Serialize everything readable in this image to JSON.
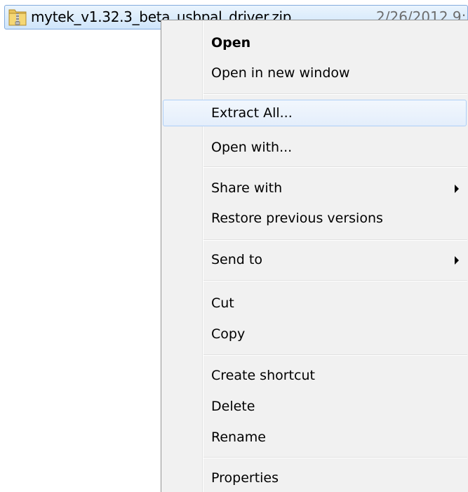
{
  "file": {
    "name": "mytek_v1.32.3_beta_usbpal_driver.zip",
    "date": "2/26/2012 9:",
    "icon": "zip-folder-icon"
  },
  "menu": {
    "items": [
      {
        "label": "Open",
        "bold": true
      },
      {
        "label": "Open in new window"
      },
      {
        "label": "Extract All...",
        "highlighted": true
      },
      {
        "label": "Open with..."
      },
      {
        "label": "Share with",
        "submenu": true
      },
      {
        "label": "Restore previous versions"
      },
      {
        "label": "Send to",
        "submenu": true
      },
      {
        "label": "Cut"
      },
      {
        "label": "Copy"
      },
      {
        "label": "Create shortcut"
      },
      {
        "label": "Delete"
      },
      {
        "label": "Rename"
      },
      {
        "label": "Properties"
      }
    ]
  },
  "colors": {
    "menu_background": "#f1f1f1",
    "highlight_border": "#aecff7",
    "selection_border": "#84acdd"
  }
}
